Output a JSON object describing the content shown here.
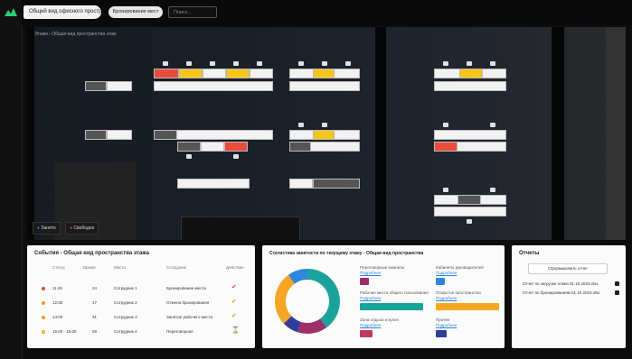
{
  "header": {
    "active_tab": "Общий вид офисного пространства",
    "tab2": "Бронирование мест",
    "search_placeholder": "Поиск..."
  },
  "map": {
    "breadcrumb": "Этажи › Общая вид пространства этаж",
    "legend": [
      {
        "label": "Занято",
        "color": "#2e86de"
      },
      {
        "label": "Свободно",
        "color": "#e74c3c"
      }
    ]
  },
  "events_panel": {
    "title": "События - Общая вид пространства этажа",
    "columns": [
      "Статус",
      "Время",
      "Место",
      "Сотрудник",
      "Событие",
      "Действие"
    ],
    "rows": [
      {
        "status_color": "#e74c3c",
        "time": "11:45",
        "place": "24",
        "employee": "Сотрудник 1",
        "event": "Бронирование места"
      },
      {
        "status_color": "#f39c12",
        "time": "12:30",
        "place": "17",
        "employee": "Сотрудник 2",
        "event": "Отмена бронирования"
      },
      {
        "status_color": "#f39c12",
        "time": "14:00",
        "place": "31",
        "employee": "Сотрудник 3",
        "event": "Занятие рабочего места"
      },
      {
        "status_color": "#f5d06b",
        "time": "15:00 - 16:00",
        "place": "08",
        "employee": "Сотрудник 4",
        "event": "Переговорная"
      }
    ]
  },
  "stats_panel": {
    "title": "Статистика занятости по текущему этажу - Общая вид пространства",
    "donut": [
      {
        "label": "Рабочие места",
        "value": 40,
        "color": "#1aa39a"
      },
      {
        "label": "Переговорные",
        "value": 15,
        "color": "#9b2f6a"
      },
      {
        "label": "Зона отдыха",
        "value": 8,
        "color": "#2f3d9b"
      },
      {
        "label": "Прочее",
        "value": 27,
        "color": "#f5a623"
      },
      {
        "label": "Кабинеты",
        "value": 10,
        "color": "#2e86de"
      }
    ],
    "legend_left": [
      {
        "title": "Переговорные комнаты",
        "link": "Подробнее",
        "color": "#9b2f6a"
      },
      {
        "title": "Рабочие места общего пользования",
        "link": "Подробнее",
        "color": "#1aa39a"
      },
      {
        "title": "Зона отдыха и кухня",
        "link": "Подробнее",
        "color": "#c2385f"
      }
    ],
    "legend_right": [
      {
        "title": "Кабинеты руководителей",
        "link": "Подробнее",
        "color": "#2e86de"
      },
      {
        "title": "Открытое пространство",
        "link": "Подробнее",
        "color": "#f5a623"
      },
      {
        "title": "Прочее",
        "link": "Подробнее",
        "color": "#2f3d9b"
      }
    ]
  },
  "reports_panel": {
    "title": "Отчеты",
    "button": "Сформировать отчет",
    "files": [
      "Отчет по загрузке этажа 01.10.2023.xlsx",
      "Отчет по бронированиям 01.10.2023.xlsx"
    ]
  }
}
